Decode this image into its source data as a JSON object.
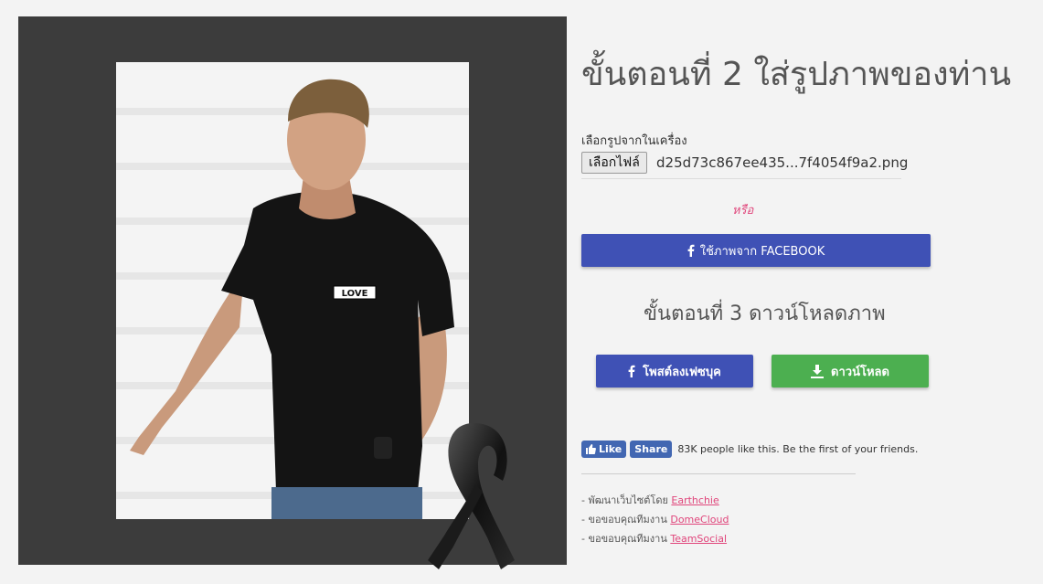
{
  "step2": {
    "title": "ขั้นตอนที่ 2 ใส่รูปภาพของท่าน"
  },
  "file": {
    "label": "เลือกรูปจากในเครื่อง",
    "button_label": "เลือกไฟล์",
    "filename": "d25d73c867ee435...7f4054f9a2.png"
  },
  "or_text": "หรือ",
  "facebook_button": {
    "label": "ใช้ภาพจาก FACEBOOK"
  },
  "step3": {
    "title": "ขั้นตอนที่ 3 ดาวน์โหลดภาพ"
  },
  "actions": {
    "post_label": "โพสต์ลงเฟซบุค",
    "download_label": "ดาวน์โหลด",
    "post_color": "#3f51b5",
    "download_color": "#4caf50"
  },
  "social": {
    "like_label": "Like",
    "share_label": "Share",
    "like_text": "83K people like this. Be the first of your friends."
  },
  "credits": [
    {
      "prefix": "- พัฒนาเว็บไซต์โดย ",
      "link": "Earthchie"
    },
    {
      "prefix": "- ขอขอบคุณทีมงาน ",
      "link": "DomeCloud"
    },
    {
      "prefix": "- ขอขอบคุณทีมงาน ",
      "link": "TeamSocial"
    }
  ],
  "shirt_text": "LOVE",
  "icons": [
    "facebook-icon",
    "download-icon",
    "thumbs-up-icon",
    "mourning-ribbon-icon"
  ]
}
